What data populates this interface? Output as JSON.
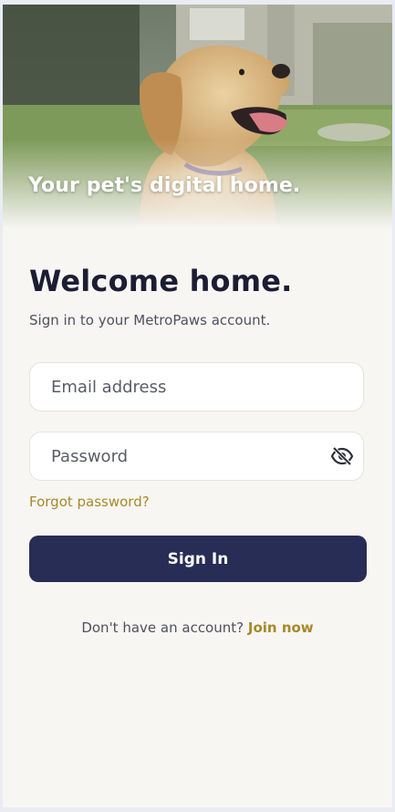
{
  "hero": {
    "tagline": "Your pet's digital home.",
    "image": "golden-retriever-puppy-photo"
  },
  "login": {
    "title": "Welcome home.",
    "subtitle": "Sign in to your MetroPaws account.",
    "email_placeholder": "Email address",
    "email_value": "",
    "password_placeholder": "Password",
    "password_value": "",
    "password_toggle_icon": "eye-off-icon",
    "forgot_label": "Forgot password?",
    "sign_in_label": "Sign In",
    "signup_prompt": "Don't have an account?",
    "join_label": "Join now"
  },
  "colors": {
    "background": "#f7f6f3",
    "primary": "#282d55",
    "accent": "#a8882a",
    "heading": "#1c1d33"
  }
}
